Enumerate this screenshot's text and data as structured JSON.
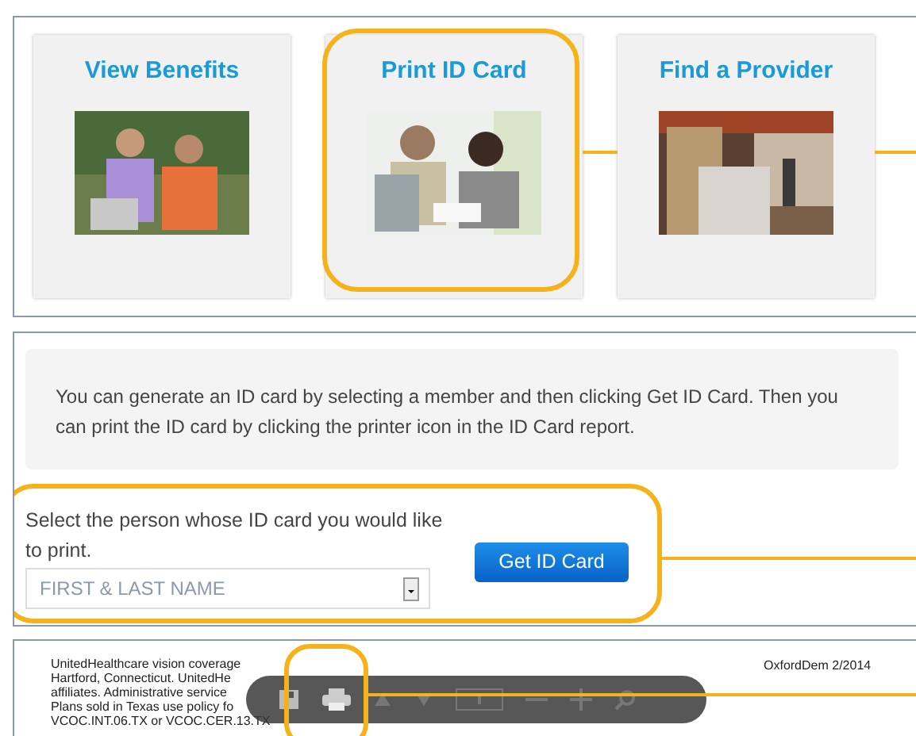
{
  "tiles": [
    {
      "title": "View Benefits",
      "highlighted": false
    },
    {
      "title": "Print ID Card",
      "highlighted": true
    },
    {
      "title": "Find a Provider",
      "highlighted": false
    }
  ],
  "info": {
    "text": "You can generate an ID card by selecting a member and then clicking Get ID Card. Then you can print the ID card by clicking the printer icon in the ID Card report."
  },
  "form": {
    "label": "Select the person whose ID card you would like to print.",
    "select_placeholder": "FIRST & LAST NAME",
    "button": "Get ID Card",
    "highlighted": true
  },
  "report": {
    "disclaimer_lines": [
      "UnitedHealthcare vision coverage",
      "Hartford, Connecticut. UnitedHe",
      "affiliates. Administrative service",
      "Plans sold in Texas use policy fo",
      "VCOC.INT.06.TX or VCOC.CER.13.TX"
    ],
    "form_code": "OxfordDem 2/2014",
    "print_highlighted": true
  }
}
